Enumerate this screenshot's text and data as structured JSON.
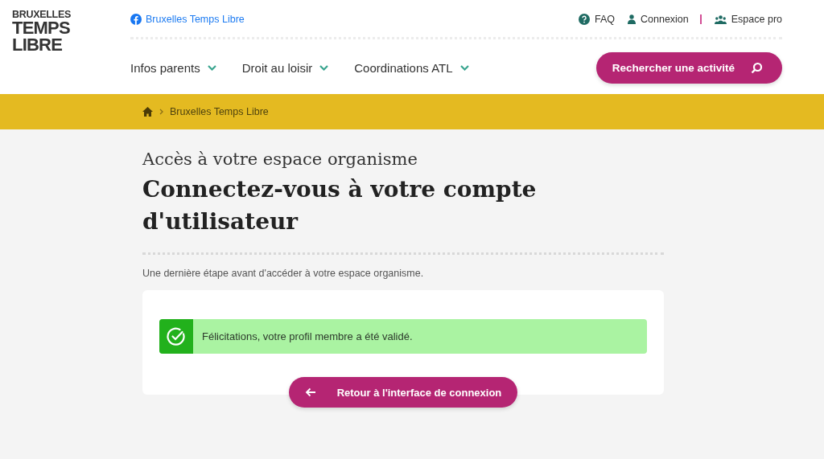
{
  "logo": {
    "lines": [
      "BRUXELLES",
      "TEMPS",
      "LIBRE"
    ]
  },
  "social_link": {
    "label": "Bruxelles Temps Libre"
  },
  "top_links": [
    {
      "kind": "help",
      "label": "FAQ"
    },
    {
      "kind": "user",
      "label": "Connexion"
    },
    {
      "kind": "group",
      "label": "Espace pro"
    }
  ],
  "nav": [
    {
      "label": "Infos parents"
    },
    {
      "label": "Droit au loisir"
    },
    {
      "label": "Coordinations ATL"
    }
  ],
  "search_button": {
    "label": "Rechercher une activité"
  },
  "breadcrumb": [
    "Bruxelles Temps Libre"
  ],
  "subtitle": "Accès à votre espace organisme",
  "title": "Connectez-vous à votre compte d'utilisateur",
  "intro": "Une dernière étape avant d'accéder à votre espace organisme.",
  "alert": {
    "kind": "success",
    "message": "Félicitations, votre profil membre a été validé."
  },
  "back_button": {
    "label": "Retour à l'interface de connexion"
  }
}
